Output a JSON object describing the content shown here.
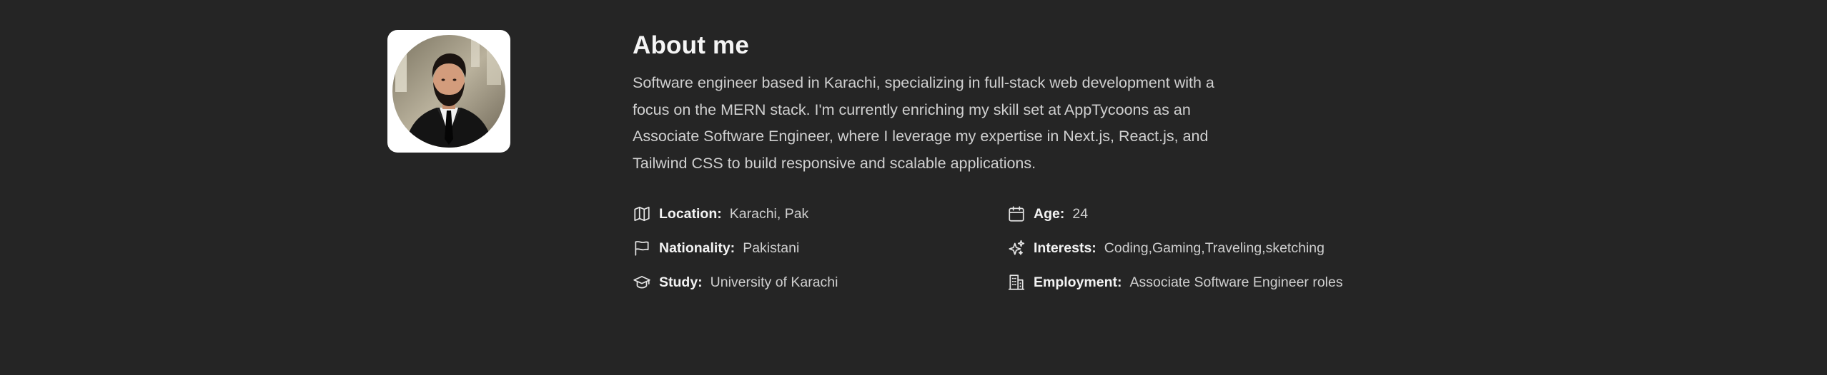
{
  "about": {
    "title": "About me",
    "bio": "Software engineer based in Karachi, specializing in full-stack web development with a focus on the MERN stack. I'm currently enriching my skill set at AppTycoons as an Associate Software Engineer, where I leverage my expertise in Next.js, React.js, and Tailwind CSS to build responsive and scalable applications."
  },
  "details": {
    "location": {
      "label": "Location:",
      "value": "Karachi, Pak",
      "icon": "map-icon"
    },
    "age": {
      "label": "Age:",
      "value": "24",
      "icon": "calendar-icon"
    },
    "nationality": {
      "label": "Nationality:",
      "value": "Pakistani",
      "icon": "flag-icon"
    },
    "interests": {
      "label": "Interests:",
      "value": "Coding,Gaming,Traveling,sketching",
      "icon": "sparkles-icon"
    },
    "study": {
      "label": "Study:",
      "value": "University of Karachi",
      "icon": "graduation-cap-icon"
    },
    "employment": {
      "label": "Employment:",
      "value": "Associate Software Engineer roles",
      "icon": "building-icon"
    }
  },
  "colors": {
    "background": "#252525",
    "title": "#f5f5f5",
    "text": "#d0d0d0",
    "card": "#ffffff"
  }
}
